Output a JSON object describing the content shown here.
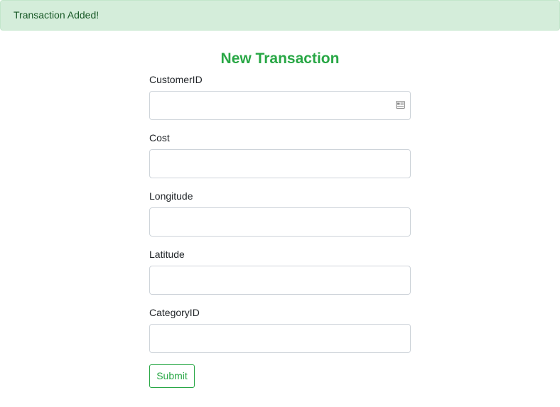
{
  "alert": {
    "message": "Transaction Added!",
    "color": "#155724",
    "background": "#d4edda"
  },
  "form": {
    "title": "New Transaction",
    "title_color": "#28a745",
    "fields": [
      {
        "label": "CustomerID",
        "value": "",
        "placeholder": "",
        "icon": "contact-card-icon"
      },
      {
        "label": "Cost",
        "value": "",
        "placeholder": ""
      },
      {
        "label": "Longitude",
        "value": "",
        "placeholder": ""
      },
      {
        "label": "Latitude",
        "value": "",
        "placeholder": ""
      },
      {
        "label": "CategoryID",
        "value": "",
        "placeholder": ""
      }
    ],
    "submit_label": "Submit",
    "submit_color": "#28a745"
  }
}
